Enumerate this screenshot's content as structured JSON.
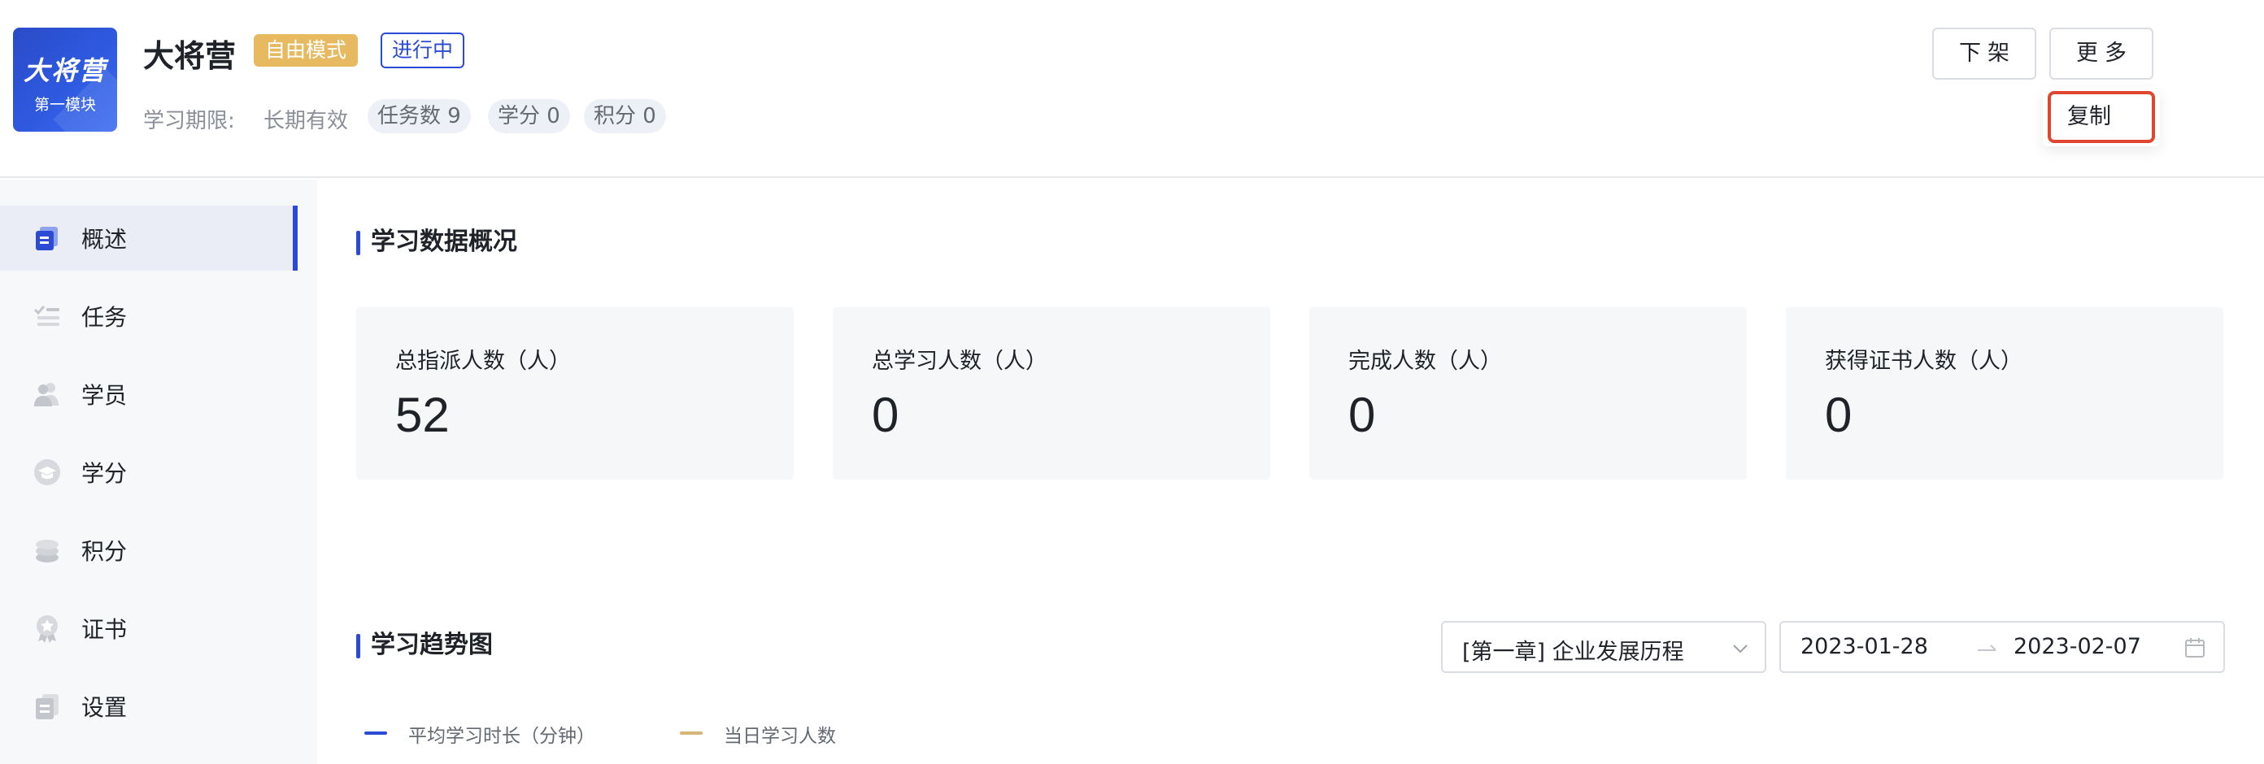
{
  "header": {
    "cover_title": "大将营",
    "cover_subtitle": "第一模块",
    "title": "大将营",
    "mode_tag": "自由模式",
    "status_tag": "进行中",
    "period_label": "学习期限:",
    "period_value": "长期有效",
    "tasks_pill": "任务数 9",
    "credit_pill": "学分 0",
    "points_pill": "积分 0",
    "offline_button": "下架",
    "more_button": "更多",
    "dropdown_copy": "复制"
  },
  "sidebar": {
    "items": [
      {
        "label": "概述",
        "icon": "overview-icon",
        "active": true
      },
      {
        "label": "任务",
        "icon": "task-list-icon"
      },
      {
        "label": "学员",
        "icon": "users-icon"
      },
      {
        "label": "学分",
        "icon": "graduation-cap-icon"
      },
      {
        "label": "积分",
        "icon": "coins-icon"
      },
      {
        "label": "证书",
        "icon": "certificate-badge-icon"
      },
      {
        "label": "设置",
        "icon": "settings-doc-icon"
      }
    ]
  },
  "overview": {
    "title": "学习数据概况",
    "stats": [
      {
        "label": "总指派人数（人）",
        "value": "52"
      },
      {
        "label": "总学习人数（人）",
        "value": "0"
      },
      {
        "label": "完成人数（人）",
        "value": "0"
      },
      {
        "label": "获得证书人数（人）",
        "value": "0"
      }
    ]
  },
  "trend": {
    "title": "学习趋势图",
    "chapter_select": "[第一章] 企业发展历程",
    "date_start": "2023-01-28",
    "date_end": "2023-02-07",
    "legend": [
      {
        "label": "平均学习时长（分钟）",
        "color": "#2b4bd4"
      },
      {
        "label": "当日学习人数",
        "color": "#d6b47a"
      }
    ]
  },
  "colors": {
    "accent": "#2b4bd4",
    "mode_tag": "#e7b961",
    "highlight_border": "#e0452f"
  }
}
